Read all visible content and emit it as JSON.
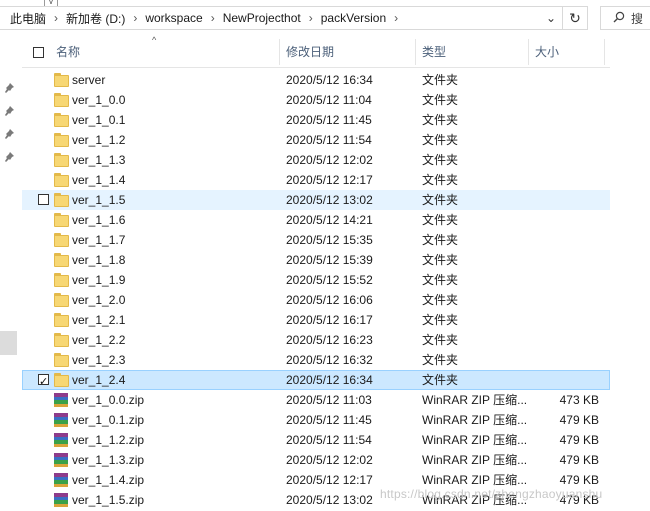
{
  "address": {
    "crumbs": [
      "此电脑",
      "新加卷 (D:)",
      "workspace",
      "NewProjecthot",
      "packVersion"
    ],
    "separator": "›",
    "dropdown_glyph": "⌄",
    "refresh_glyph": "↻"
  },
  "search": {
    "placeholder": "搜"
  },
  "top_chevron": "v",
  "columns": {
    "name": "名称",
    "date": "修改日期",
    "type": "类型",
    "size": "大小"
  },
  "sort_arrow": "^",
  "rows": [
    {
      "name": "server",
      "date": "2020/5/12 16:34",
      "type": "文件夹",
      "size": "",
      "icon": "folder-icon"
    },
    {
      "name": "ver_1_0.0",
      "date": "2020/5/12 11:04",
      "type": "文件夹",
      "size": "",
      "icon": "folder-icon"
    },
    {
      "name": "ver_1_0.1",
      "date": "2020/5/12 11:45",
      "type": "文件夹",
      "size": "",
      "icon": "folder-icon"
    },
    {
      "name": "ver_1_1.2",
      "date": "2020/5/12 11:54",
      "type": "文件夹",
      "size": "",
      "icon": "folder-icon"
    },
    {
      "name": "ver_1_1.3",
      "date": "2020/5/12 12:02",
      "type": "文件夹",
      "size": "",
      "icon": "folder-icon"
    },
    {
      "name": "ver_1_1.4",
      "date": "2020/5/12 12:17",
      "type": "文件夹",
      "size": "",
      "icon": "folder-icon"
    },
    {
      "name": "ver_1_1.5",
      "date": "2020/5/12 13:02",
      "type": "文件夹",
      "size": "",
      "icon": "folder-icon",
      "state": "hover"
    },
    {
      "name": "ver_1_1.6",
      "date": "2020/5/12 14:21",
      "type": "文件夹",
      "size": "",
      "icon": "folder-icon"
    },
    {
      "name": "ver_1_1.7",
      "date": "2020/5/12 15:35",
      "type": "文件夹",
      "size": "",
      "icon": "folder-icon"
    },
    {
      "name": "ver_1_1.8",
      "date": "2020/5/12 15:39",
      "type": "文件夹",
      "size": "",
      "icon": "folder-icon"
    },
    {
      "name": "ver_1_1.9",
      "date": "2020/5/12 15:52",
      "type": "文件夹",
      "size": "",
      "icon": "folder-icon"
    },
    {
      "name": "ver_1_2.0",
      "date": "2020/5/12 16:06",
      "type": "文件夹",
      "size": "",
      "icon": "folder-icon"
    },
    {
      "name": "ver_1_2.1",
      "date": "2020/5/12 16:17",
      "type": "文件夹",
      "size": "",
      "icon": "folder-icon"
    },
    {
      "name": "ver_1_2.2",
      "date": "2020/5/12 16:23",
      "type": "文件夹",
      "size": "",
      "icon": "folder-icon"
    },
    {
      "name": "ver_1_2.3",
      "date": "2020/5/12 16:32",
      "type": "文件夹",
      "size": "",
      "icon": "folder-icon"
    },
    {
      "name": "ver_1_2.4",
      "date": "2020/5/12 16:34",
      "type": "文件夹",
      "size": "",
      "icon": "folder-icon",
      "state": "selected"
    },
    {
      "name": "ver_1_0.0.zip",
      "date": "2020/5/12 11:03",
      "type": "WinRAR ZIP 压缩...",
      "size": "473 KB",
      "icon": "winrar-zip-icon"
    },
    {
      "name": "ver_1_0.1.zip",
      "date": "2020/5/12 11:45",
      "type": "WinRAR ZIP 压缩...",
      "size": "479 KB",
      "icon": "winrar-zip-icon"
    },
    {
      "name": "ver_1_1.2.zip",
      "date": "2020/5/12 11:54",
      "type": "WinRAR ZIP 压缩...",
      "size": "479 KB",
      "icon": "winrar-zip-icon"
    },
    {
      "name": "ver_1_1.3.zip",
      "date": "2020/5/12 12:02",
      "type": "WinRAR ZIP 压缩...",
      "size": "479 KB",
      "icon": "winrar-zip-icon"
    },
    {
      "name": "ver_1_1.4.zip",
      "date": "2020/5/12 12:17",
      "type": "WinRAR ZIP 压缩...",
      "size": "479 KB",
      "icon": "winrar-zip-icon"
    },
    {
      "name": "ver_1_1.5.zip",
      "date": "2020/5/12 13:02",
      "type": "WinRAR ZIP 压缩...",
      "size": "479 KB",
      "icon": "winrar-zip-icon"
    }
  ],
  "watermark": "https://blog.csdn.net/zhengzhaoyuanshu",
  "colors": {
    "hover": "#e5f3ff",
    "selected": "#cce8ff",
    "folder": "#f7d774",
    "header_text": "#4c607a"
  }
}
